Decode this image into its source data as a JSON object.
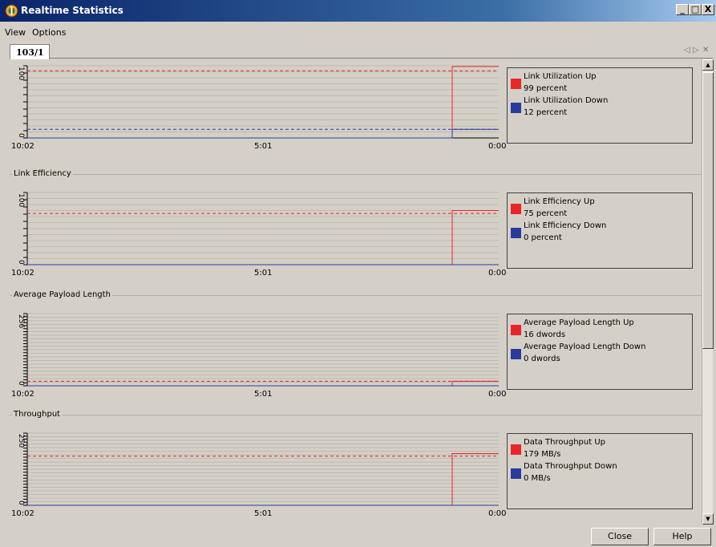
{
  "window": {
    "title": "Realtime Statistics",
    "minimize": "_",
    "maximize": "□",
    "close": "X"
  },
  "menu": [
    "View",
    "Options"
  ],
  "tab": {
    "label": "103/1"
  },
  "tabnav": {
    "prev": "◁",
    "next": "▷",
    "close": "✕"
  },
  "groups": [
    {
      "label": "",
      "ymax": "100",
      "ymin": "0",
      "x_left": "10:02",
      "x_mid": "5:01",
      "x_right": "0:00",
      "legend": [
        {
          "name": "Link Utilization Up",
          "value": "99 percent",
          "color": "#e8262a"
        },
        {
          "name": "Link Utilization Down",
          "value": "12 percent",
          "color": "#2a3b9c"
        }
      ]
    },
    {
      "label": "Link Efficiency",
      "ymax": "100",
      "ymin": "0",
      "x_left": "10:02",
      "x_mid": "5:01",
      "x_right": "0:00",
      "legend": [
        {
          "name": "Link Efficiency Up",
          "value": "75 percent",
          "color": "#e8262a"
        },
        {
          "name": "Link Efficiency Down",
          "value": "0 percent",
          "color": "#2a3b9c"
        }
      ]
    },
    {
      "label": "Average Payload Length",
      "ymax": "256",
      "ymin": "0",
      "x_left": "10:02",
      "x_mid": "5:01",
      "x_right": "0:00",
      "legend": [
        {
          "name": "Average Payload Length Up",
          "value": "16 dwords",
          "color": "#e8262a"
        },
        {
          "name": "Average Payload Length Down",
          "value": "0 dwords",
          "color": "#2a3b9c"
        }
      ]
    },
    {
      "label": "Throughput",
      "ymax": "250",
      "ymin": "0",
      "x_left": "10:02",
      "x_mid": "5:01",
      "x_right": "0:00",
      "legend": [
        {
          "name": "Data Throughput Up",
          "value": "179 MB/s",
          "color": "#e8262a"
        },
        {
          "name": "Data Throughput Down",
          "value": "0 MB/s",
          "color": "#2a3b9c"
        }
      ]
    }
  ],
  "chart_data": [
    {
      "type": "line",
      "ylim": [
        0,
        100
      ],
      "x_ticks": [
        "10:02",
        "5:01",
        "0:00"
      ],
      "series": [
        {
          "name": "Link Utilization Up",
          "current": 99,
          "average": 93
        },
        {
          "name": "Link Utilization Down",
          "current": 12,
          "average": 12
        }
      ]
    },
    {
      "type": "line",
      "ylim": [
        0,
        100
      ],
      "x_ticks": [
        "10:02",
        "5:01",
        "0:00"
      ],
      "series": [
        {
          "name": "Link Efficiency Up",
          "current": 75,
          "average": 71
        },
        {
          "name": "Link Efficiency Down",
          "current": 0,
          "average": 0
        }
      ]
    },
    {
      "type": "line",
      "ylim": [
        0,
        256
      ],
      "x_ticks": [
        "10:02",
        "5:01",
        "0:00"
      ],
      "series": [
        {
          "name": "Average Payload Length Up",
          "current": 16,
          "average": 16
        },
        {
          "name": "Average Payload Length Down",
          "current": 0,
          "average": 0
        }
      ]
    },
    {
      "type": "line",
      "ylim": [
        0,
        250
      ],
      "x_ticks": [
        "10:02",
        "5:01",
        "0:00"
      ],
      "series": [
        {
          "name": "Data Throughput Up",
          "current": 179,
          "average": 170
        },
        {
          "name": "Data Throughput Down",
          "current": 0,
          "average": 0
        }
      ]
    }
  ],
  "buttons": {
    "close": "Close",
    "help": "Help"
  }
}
